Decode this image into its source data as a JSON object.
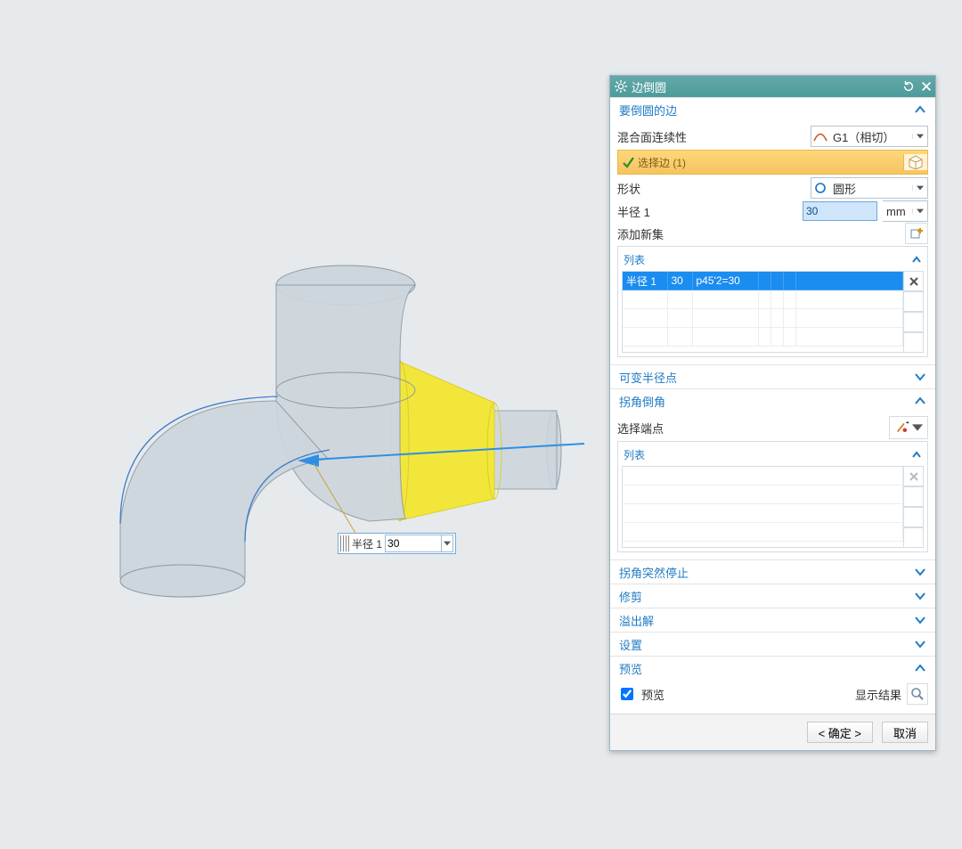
{
  "dialog": {
    "title": "边倒圆",
    "sections": {
      "edges": {
        "title": "要倒圆的边",
        "continuity_label": "混合面连续性",
        "continuity_value": "G1（相切）",
        "select_edge_label": "选择边 (1)",
        "shape_label": "形状",
        "shape_value": "圆形",
        "radius_label": "半径 1",
        "radius_value": "30",
        "radius_unit": "mm",
        "add_set_label": "添加新集",
        "list_title": "列表",
        "list_row": {
          "c1": "半径 1",
          "c2": "30",
          "c3": "p45'2=30"
        }
      },
      "var_radius": {
        "title": "可变半径点"
      },
      "corner": {
        "title": "拐角倒角",
        "select_endpoint_label": "选择端点",
        "list_title": "列表"
      },
      "stop": {
        "title": "拐角突然停止"
      },
      "trim": {
        "title": "修剪"
      },
      "overflow": {
        "title": "溢出解"
      },
      "settings": {
        "title": "设置"
      },
      "preview": {
        "title": "预览",
        "checkbox_label": "预览",
        "show_result_label": "显示结果"
      }
    },
    "buttons": {
      "ok": "< 确定 >",
      "cancel": "取消"
    }
  },
  "scene_popup": {
    "label": "半径 1",
    "value": "30"
  }
}
